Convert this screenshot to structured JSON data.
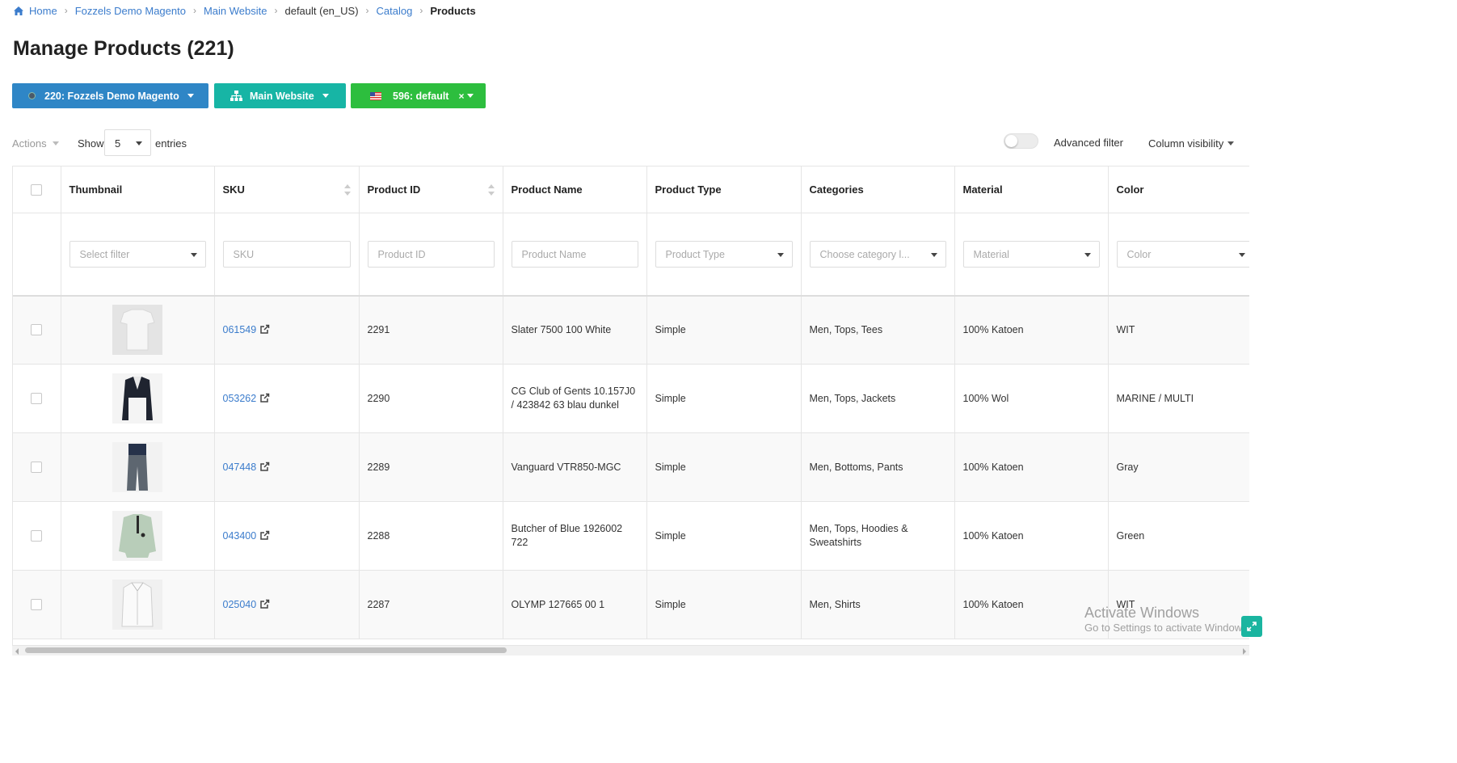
{
  "breadcrumb": {
    "home": "Home",
    "store": "Fozzels Demo Magento",
    "website": "Main Website",
    "view": "default (en_US)",
    "catalog": "Catalog",
    "current": "Products"
  },
  "page_title": "Manage Products (221)",
  "context": {
    "store_button": "220: Fozzels Demo Magento",
    "website_button": "Main Website",
    "view_button": "596: default",
    "view_clear": "×"
  },
  "toolbar": {
    "actions_label": "Actions",
    "show_label": "Show",
    "entries_value": "5",
    "entries_label": "entries",
    "advanced_filter_label": "Advanced filter",
    "advanced_filter_on": false,
    "column_visibility_label": "Column visibility"
  },
  "columns": {
    "thumbnail": "Thumbnail",
    "sku": "SKU",
    "product_id": "Product ID",
    "product_name": "Product Name",
    "product_type": "Product Type",
    "categories": "Categories",
    "material": "Material",
    "color": "Color"
  },
  "filters": {
    "thumbnail": "Select filter",
    "sku": "SKU",
    "product_id": "Product ID",
    "product_name": "Product Name",
    "product_type": "Product Type",
    "categories": "Choose category l...",
    "material": "Material",
    "color": "Color"
  },
  "rows": [
    {
      "sku": "061549",
      "product_id": "2291",
      "name": "Slater 7500 100 White",
      "type": "Simple",
      "categories": "Men, Tops, Tees",
      "material": "100% Katoen",
      "color": "WIT"
    },
    {
      "sku": "053262",
      "product_id": "2290",
      "name": "CG Club of Gents 10.157J0 / 423842 63 blau dunkel",
      "type": "Simple",
      "categories": "Men, Tops, Jackets",
      "material": "100% Wol",
      "color": "MARINE / MULTI"
    },
    {
      "sku": "047448",
      "product_id": "2289",
      "name": "Vanguard VTR850-MGC",
      "type": "Simple",
      "categories": "Men, Bottoms, Pants",
      "material": "100% Katoen",
      "color": "Gray"
    },
    {
      "sku": "043400",
      "product_id": "2288",
      "name": "Butcher of Blue 1926002 722",
      "type": "Simple",
      "categories": "Men, Tops, Hoodies & Sweatshirts",
      "material": "100% Katoen",
      "color": "Green"
    },
    {
      "sku": "025040",
      "product_id": "2287",
      "name": "OLYMP 127665 00 1",
      "type": "Simple",
      "categories": "Men, Shirts",
      "material": "100% Katoen",
      "color": "WIT"
    }
  ],
  "watermark": {
    "title": "Activate Windows",
    "subtitle": "Go to Settings to activate Windows."
  },
  "icons": {
    "home": "home-icon",
    "external_link": "external-link-icon",
    "sitemap": "sitemap-icon",
    "flag": "us-flag-icon",
    "expand": "expand-icon"
  },
  "colors": {
    "link": "#3b7ccc",
    "store_button": "#2f86c6",
    "website_button": "#17b5a5",
    "view_button": "#2dbe3e"
  }
}
